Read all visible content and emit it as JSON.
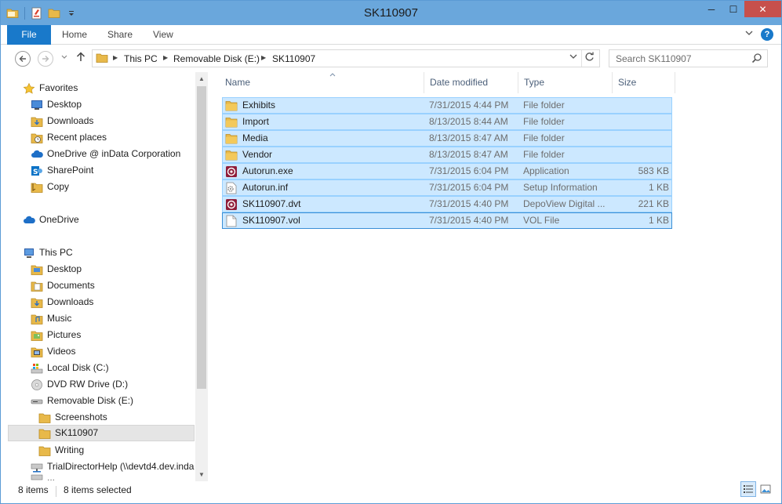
{
  "window": {
    "title": "SK110907",
    "controls": {
      "minimize": "─",
      "maximize": "☐",
      "close": "✕"
    }
  },
  "ribbon": {
    "tabs": [
      "File",
      "Home",
      "Share",
      "View"
    ],
    "help": "?"
  },
  "address": {
    "crumbs": [
      "This PC",
      "Removable Disk (E:)",
      "SK110907"
    ],
    "search_placeholder": "Search SK110907"
  },
  "nav": {
    "favorites": {
      "label": "Favorites",
      "items": [
        "Desktop",
        "Downloads",
        "Recent places",
        "OneDrive @ inData Corporation",
        "SharePoint",
        "Copy"
      ]
    },
    "onedrive": "OneDrive",
    "thispc": {
      "label": "This PC",
      "items": [
        "Desktop",
        "Documents",
        "Downloads",
        "Music",
        "Pictures",
        "Videos",
        "Local Disk (C:)",
        "DVD RW Drive (D:)",
        "Removable Disk (E:)"
      ],
      "removable_children": [
        "Screenshots",
        "SK110907",
        "Writing"
      ],
      "network": "TrialDirectorHelp (\\\\devtd4.dev.inda",
      "more": "..."
    },
    "selected": "SK110907"
  },
  "columns": {
    "name": "Name",
    "date": "Date modified",
    "type": "Type",
    "size": "Size"
  },
  "files": [
    {
      "name": "Exhibits",
      "date": "7/31/2015 4:44 PM",
      "type": "File folder",
      "size": "",
      "icon": "folder-icon"
    },
    {
      "name": "Import",
      "date": "8/13/2015 8:44 AM",
      "type": "File folder",
      "size": "",
      "icon": "folder-icon"
    },
    {
      "name": "Media",
      "date": "8/13/2015 8:47 AM",
      "type": "File folder",
      "size": "",
      "icon": "folder-icon"
    },
    {
      "name": "Vendor",
      "date": "8/13/2015 8:47 AM",
      "type": "File folder",
      "size": "",
      "icon": "folder-icon"
    },
    {
      "name": "Autorun.exe",
      "date": "7/31/2015 6:04 PM",
      "type": "Application",
      "size": "583 KB",
      "icon": "app-icon"
    },
    {
      "name": "Autorun.inf",
      "date": "7/31/2015 6:04 PM",
      "type": "Setup Information",
      "size": "1 KB",
      "icon": "settings-file-icon"
    },
    {
      "name": "SK110907.dvt",
      "date": "7/31/2015 4:40 PM",
      "type": "DepoView Digital ...",
      "size": "221 KB",
      "icon": "app-icon"
    },
    {
      "name": "SK110907.vol",
      "date": "7/31/2015 4:40 PM",
      "type": "VOL File",
      "size": "1 KB",
      "icon": "file-icon"
    }
  ],
  "status": {
    "count": "8 items",
    "selected": "8 items selected"
  },
  "colors": {
    "titlebar": "#6aa7dc",
    "file_tab": "#1979ca",
    "selection": "#cce8ff",
    "selection_border": "#99d1ff",
    "close": "#c7504c"
  }
}
